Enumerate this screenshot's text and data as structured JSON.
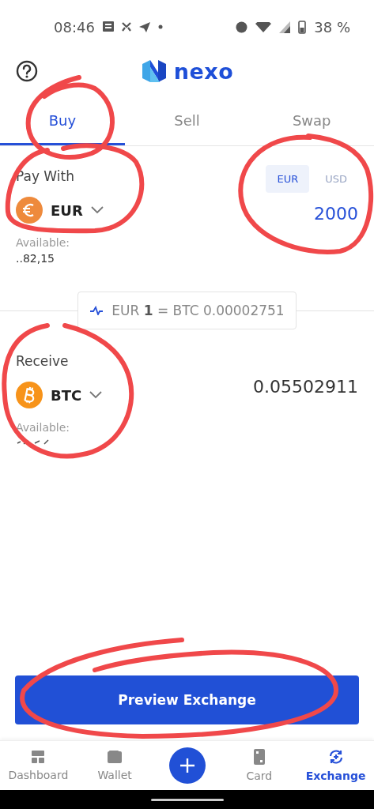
{
  "status_bar": {
    "time": "08:46",
    "battery": "38 %"
  },
  "header": {
    "logo_text": "nexo"
  },
  "tabs": [
    {
      "label": "Buy",
      "selected": true
    },
    {
      "label": "Sell",
      "selected": false
    },
    {
      "label": "Swap",
      "selected": false
    }
  ],
  "pay_with": {
    "label": "Pay With",
    "currency": "EUR",
    "available_label": "Available:",
    "available_value": "..82,15",
    "amount": "2000",
    "units": [
      {
        "label": "EUR",
        "selected": true
      },
      {
        "label": "USD",
        "selected": false
      }
    ]
  },
  "rate": "EUR **1** = BTC 0.00002751",
  "receive": {
    "label": "Receive",
    "currency": "BTC",
    "available_label": "Available:",
    "amount": "0.05502911"
  },
  "button": "Preview Exchange",
  "nav": [
    {
      "label": "Dashboard",
      "kind": "dashboard",
      "selected": false
    },
    {
      "label": "Wallet",
      "kind": "wallet",
      "selected": false
    },
    {
      "kind": "add",
      "selected": false
    },
    {
      "label": "Card",
      "kind": "card",
      "selected": false
    },
    {
      "label": "Exchange",
      "kind": "exchange",
      "selected": true
    }
  ]
}
